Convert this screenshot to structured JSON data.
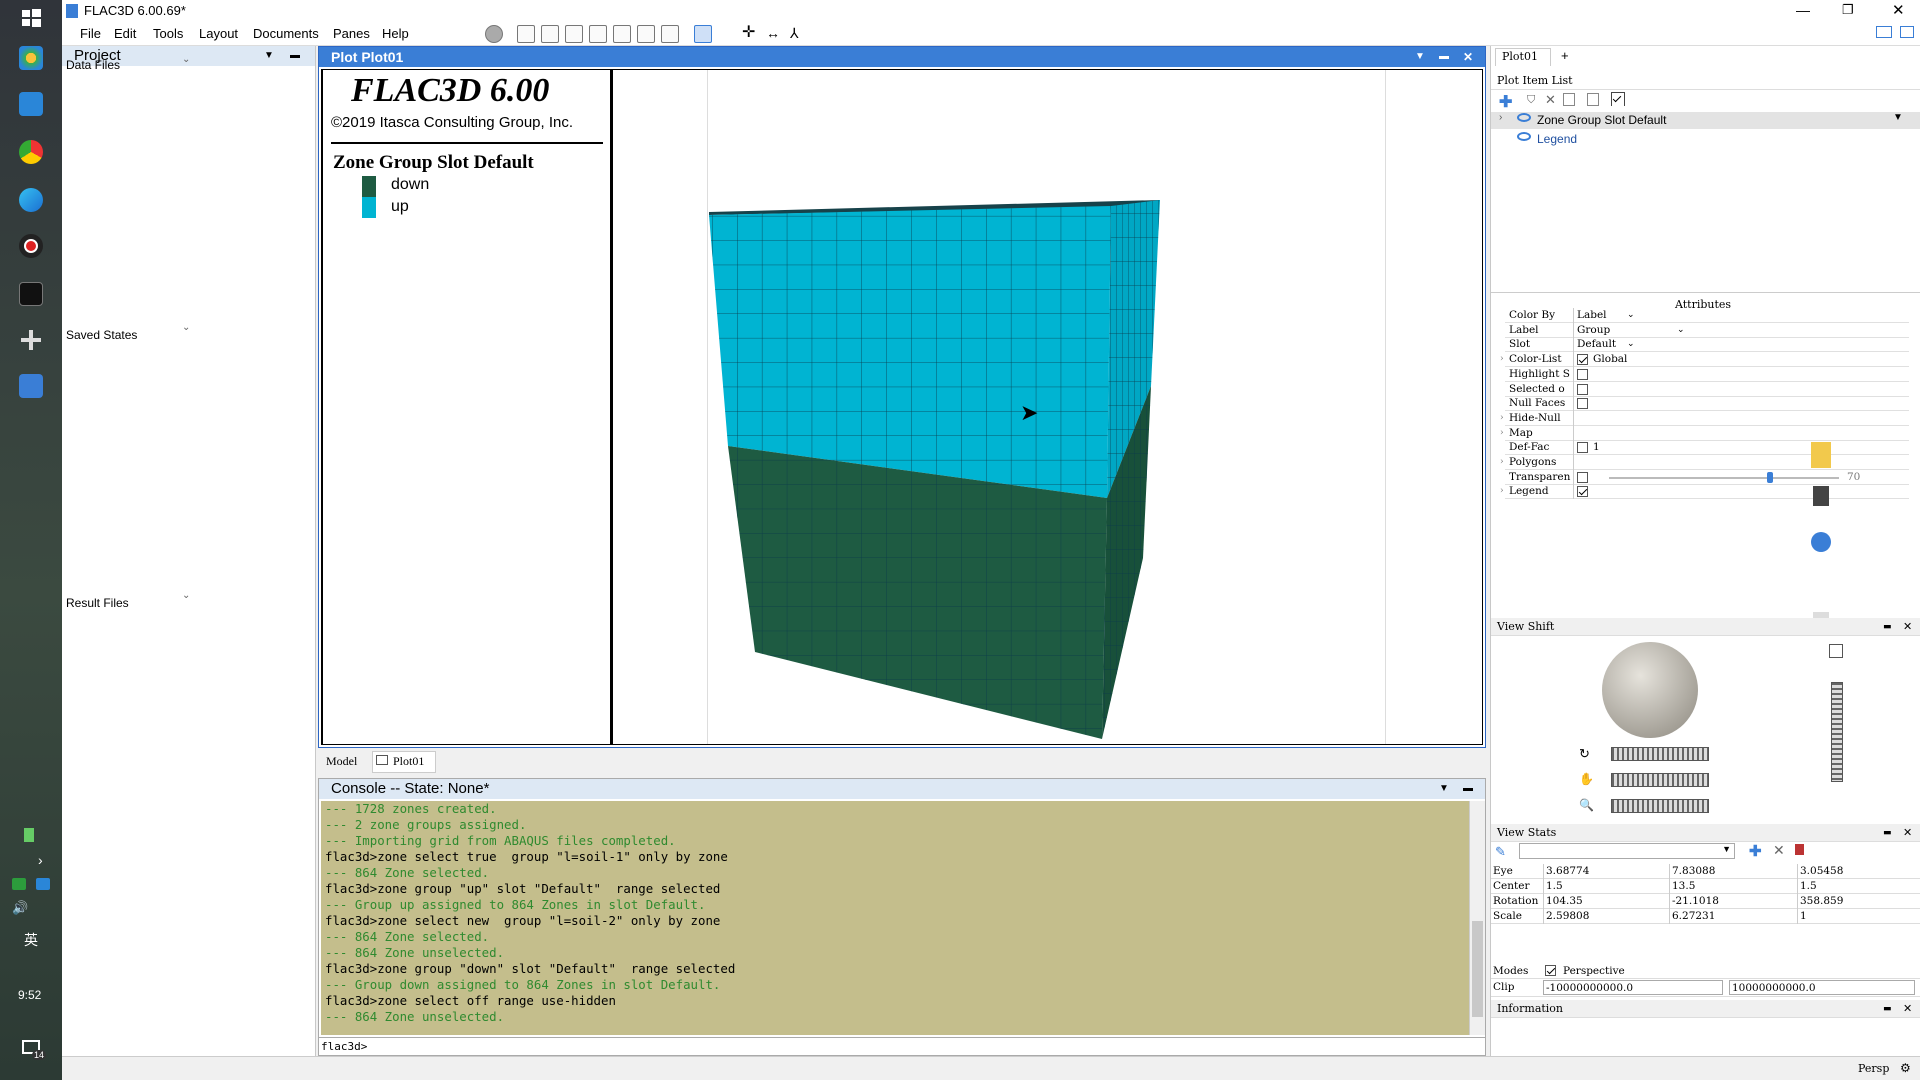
{
  "window": {
    "title": "FLAC3D 6.00.69*"
  },
  "menu": [
    "File",
    "Edit",
    "Tools",
    "Layout",
    "Documents",
    "Panes",
    "Help"
  ],
  "taskbar": {
    "time": "9:52",
    "ime": "英",
    "notif_count": "14"
  },
  "project": {
    "title": "Project",
    "sections": [
      "Data Files",
      "Saved States",
      "Result Files"
    ]
  },
  "plot": {
    "title": "Plot Plot01",
    "legend": {
      "app": "FLAC3D 6.00",
      "copyright": "©2019 Itasca Consulting Group, Inc.",
      "heading": "Zone Group Slot Default",
      "items": [
        {
          "label": "down",
          "color": "#1e5b42"
        },
        {
          "label": "up",
          "color": "#00b4d2"
        }
      ]
    },
    "colors": {
      "up": "#00b4d2",
      "down": "#1e5b42"
    }
  },
  "tabs": [
    "Model",
    "Plot01"
  ],
  "console": {
    "title": "Console -- State: None*",
    "lines": [
      {
        "t": "--- 1728 zones created.",
        "c": "g"
      },
      {
        "t": "--- 2 zone groups assigned.",
        "c": "g"
      },
      {
        "t": "--- Importing grid from ABAQUS files completed.",
        "c": "g"
      },
      {
        "t": "flac3d>zone select true  group \"l=soil-1\" only by zone",
        "c": "k"
      },
      {
        "t": "--- 864 Zone selected.",
        "c": "g"
      },
      {
        "t": "flac3d>zone group \"up\" slot \"Default\"  range selected",
        "c": "k"
      },
      {
        "t": "--- Group up assigned to 864 Zones in slot Default.",
        "c": "g"
      },
      {
        "t": "flac3d>zone select new  group \"l=soil-2\" only by zone",
        "c": "k"
      },
      {
        "t": "--- 864 Zone selected.",
        "c": "g"
      },
      {
        "t": "--- 864 Zone unselected.",
        "c": "g"
      },
      {
        "t": "flac3d>zone group \"down\" slot \"Default\"  range selected",
        "c": "k"
      },
      {
        "t": "--- Group down assigned to 864 Zones in slot Default.",
        "c": "g"
      },
      {
        "t": "flac3d>zone select off range use-hidden",
        "c": "k"
      },
      {
        "t": "--- 864 Zone unselected.",
        "c": "g"
      }
    ],
    "prompt": "flac3d>"
  },
  "right": {
    "tab": "Plot01",
    "plot_item_list": "Plot Item List",
    "items": [
      "Zone Group Slot Default",
      "Legend"
    ],
    "attributes_title": "Attributes",
    "attributes": [
      {
        "k": "Color By",
        "v": "Label"
      },
      {
        "k": "Label",
        "v": "Group"
      },
      {
        "k": "Slot",
        "v": "Default"
      },
      {
        "k": "Color-List",
        "v": "Global"
      },
      {
        "k": "Highlight S",
        "v": ""
      },
      {
        "k": "Selected o",
        "v": ""
      },
      {
        "k": "Null Faces",
        "v": ""
      },
      {
        "k": "Hide-Null",
        "v": ""
      },
      {
        "k": "Map",
        "v": ""
      },
      {
        "k": "Def-Fac",
        "v": "1"
      },
      {
        "k": "Polygons",
        "v": ""
      },
      {
        "k": "Transparen",
        "v": "70"
      },
      {
        "k": "Legend",
        "v": ""
      }
    ],
    "view_shift": "View Shift",
    "view_stats": "View Stats",
    "stats": [
      {
        "k": "Eye",
        "a": "3.68774",
        "b": "7.83088",
        "c": "3.05458"
      },
      {
        "k": "Center",
        "a": "1.5",
        "b": "13.5",
        "c": "1.5"
      },
      {
        "k": "Rotation",
        "a": "104.35",
        "b": "-21.1018",
        "c": "358.859"
      },
      {
        "k": "Scale",
        "a": "2.59808",
        "b": "6.27231",
        "c": "1"
      }
    ],
    "modes_label": "Modes",
    "modes_value": "Perspective",
    "clip_label": "Clip",
    "clip_a": "-10000000000.0",
    "clip_b": "10000000000.0",
    "information": "Information"
  },
  "status": {
    "mode": "Persp"
  }
}
